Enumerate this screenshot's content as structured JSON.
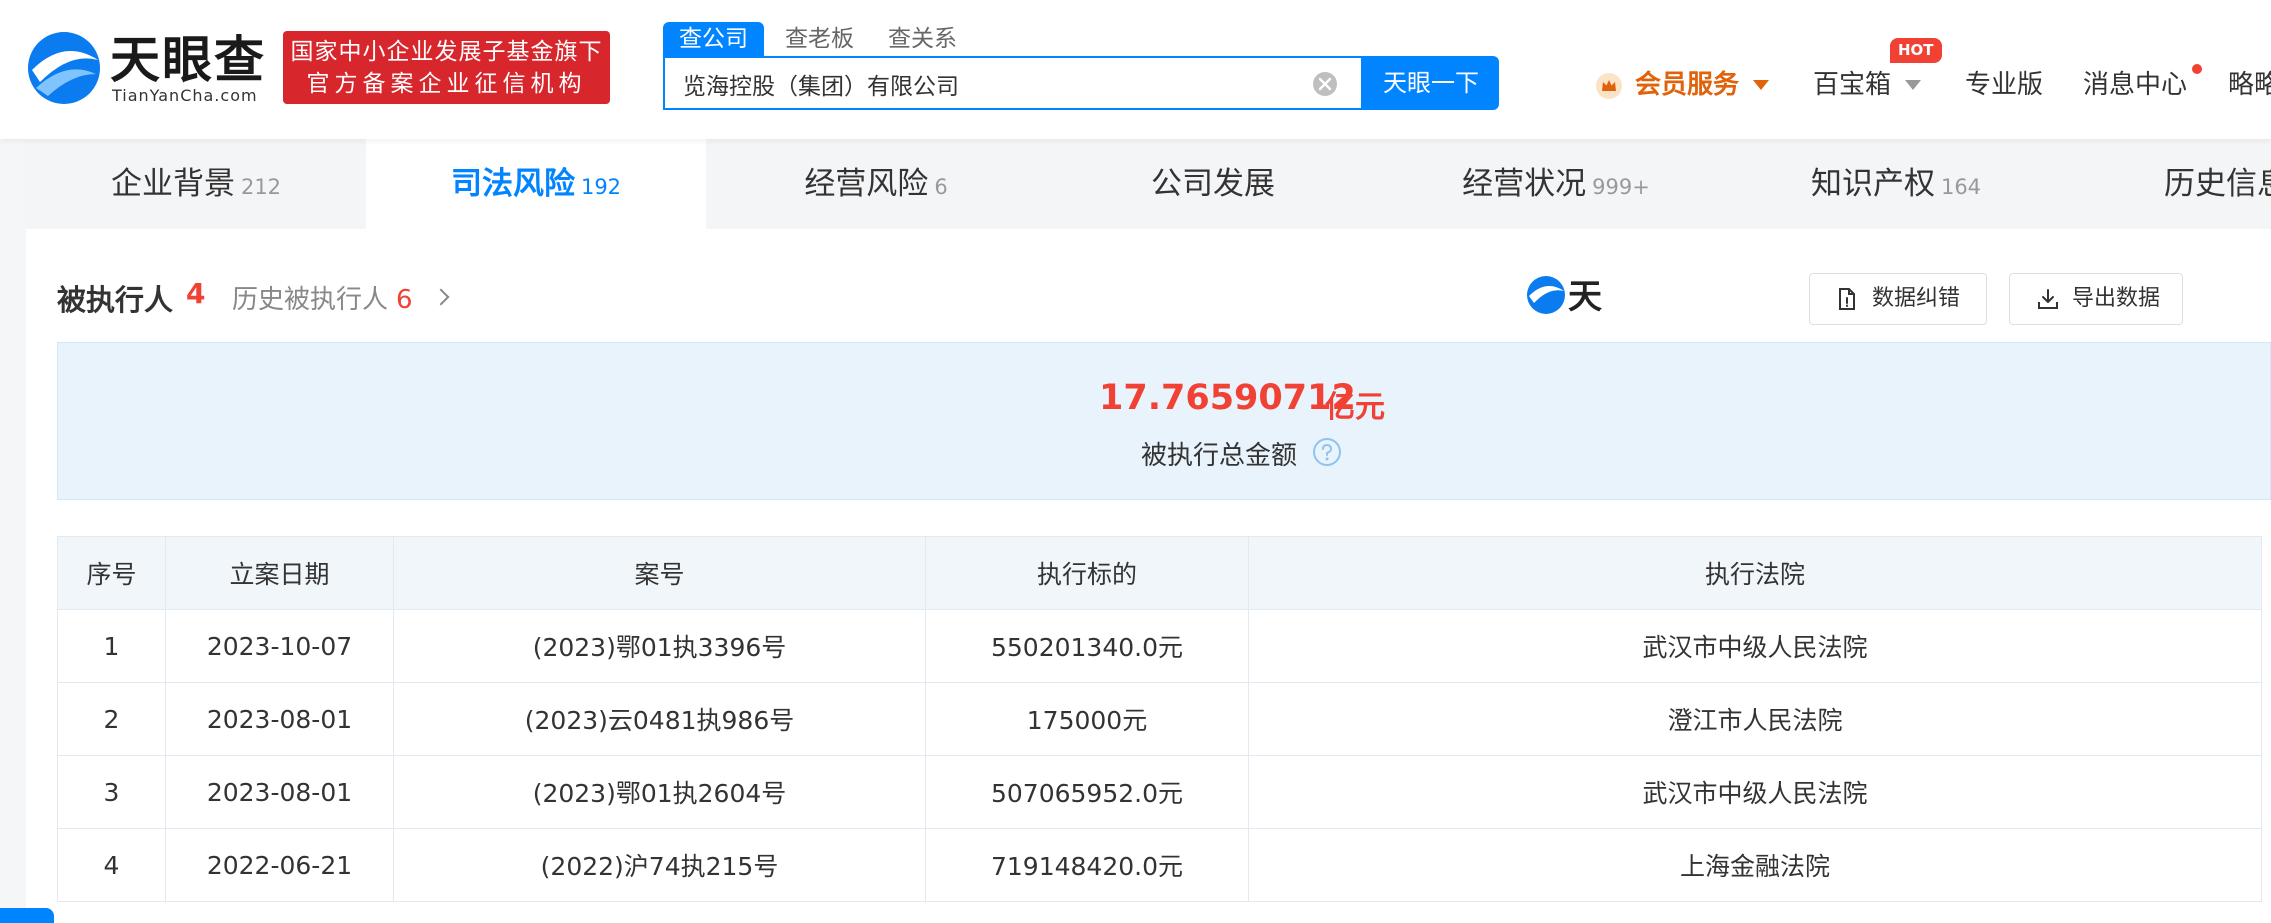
{
  "header": {
    "logo_cn": "天眼查",
    "logo_en": "TianYanCha.com",
    "badge_line1": "国家中小企业发展子基金旗下",
    "badge_line2": "官方备案企业征信机构",
    "search_tabs": [
      "查公司",
      "查老板",
      "查关系"
    ],
    "search_value": "览海控股（集团）有限公司",
    "search_button": "天眼一下",
    "nav": {
      "vip": "会员服务",
      "toolbox": "百宝箱",
      "hot": "HOT",
      "pro": "专业版",
      "messages": "消息中心",
      "more": "略略"
    }
  },
  "tabs": [
    {
      "label": "企业背景",
      "count": "212"
    },
    {
      "label": "司法风险",
      "count": "192"
    },
    {
      "label": "经营风险",
      "count": "6"
    },
    {
      "label": "公司发展",
      "count": ""
    },
    {
      "label": "经营状况",
      "count": "999+"
    },
    {
      "label": "知识产权",
      "count": "164"
    },
    {
      "label": "历史信息",
      "count": ""
    }
  ],
  "section": {
    "title": "被执行人",
    "count": "4",
    "history_label": "历史被执行人",
    "history_count": "6",
    "btn_correct": "数据纠错",
    "btn_export": "导出数据",
    "brand_fragment": "天"
  },
  "summary": {
    "amount": "17.76590712",
    "unit": "亿元",
    "label": "被执行总金额"
  },
  "table": {
    "headers": [
      "序号",
      "立案日期",
      "案号",
      "执行标的",
      "执行法院"
    ],
    "rows": [
      [
        "1",
        "2023-10-07",
        "(2023)鄂01执3396号",
        "550201340.0元",
        "武汉市中级人民法院"
      ],
      [
        "2",
        "2023-08-01",
        "(2023)云0481执986号",
        "175000元",
        "澄江市人民法院"
      ],
      [
        "3",
        "2023-08-01",
        "(2023)鄂01执2604号",
        "507065952.0元",
        "武汉市中级人民法院"
      ],
      [
        "4",
        "2022-06-21",
        "(2022)沪74执215号",
        "719148420.0元",
        "上海金融法院"
      ]
    ]
  },
  "colors": {
    "primary": "#0084ff",
    "danger": "#f04134",
    "badge": "#d8262d",
    "vip": "#e0620a"
  }
}
